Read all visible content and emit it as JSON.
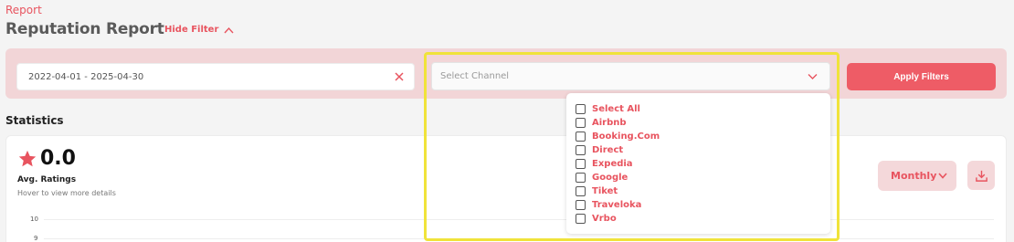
{
  "breadcrumb": "Report",
  "page_title": "Reputation Report",
  "hide_filter_label": "Hide Filter",
  "filters": {
    "date_range": "2022-04-01 - 2025-04-30",
    "channel_placeholder": "Select Channel",
    "apply_label": "Apply Filters"
  },
  "channel_options": [
    "Select All",
    "Airbnb",
    "Booking.Com",
    "Direct",
    "Expedia",
    "Google",
    "Tiket",
    "Traveloka",
    "Vrbo"
  ],
  "statistics": {
    "title": "Statistics",
    "rating_value": "0.0",
    "rating_label": "Avg. Ratings",
    "hint": "Hover to view more details",
    "y_ticks": [
      "10",
      "9"
    ],
    "period_select": "Monthly"
  },
  "colors": {
    "accent": "#e8545f",
    "apply_button": "#ee5c66",
    "filter_bar": "#f2d5d7",
    "highlight": "#f0e33a"
  },
  "icons": {
    "hide_filter": "chevron-up-icon",
    "clear_date": "close-icon",
    "channel_dropdown": "chevron-down-icon",
    "rating": "star-icon",
    "period_dropdown": "chevron-down-icon",
    "download": "download-icon"
  }
}
